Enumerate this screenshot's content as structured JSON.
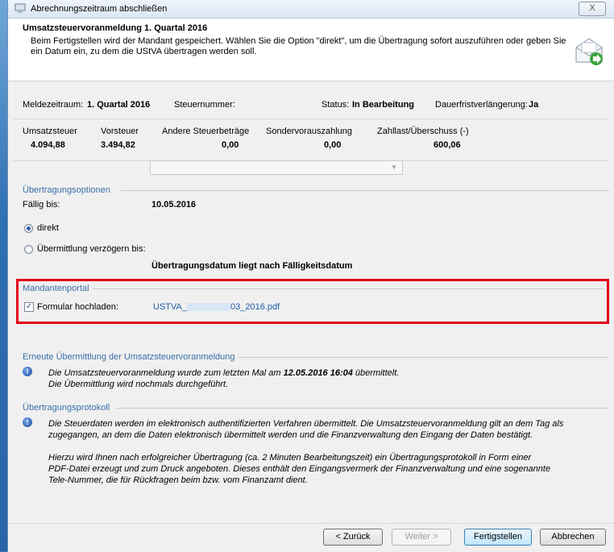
{
  "window": {
    "title": "Abrechnungszeitraum abschließen",
    "close_label": "X"
  },
  "header": {
    "title": "Umsatzsteuervoranmeldung 1. Quartal 2016",
    "description": "Beim Fertigstellen wird der Mandant gespeichert. Wählen Sie die Option \"direkt\", um die Übertragung sofort auszuführen oder geben Sie ein Datum ein, zu dem die UStVA übertragen werden soll."
  },
  "summary": {
    "meldezeitraum_label": "Meldezeitraum:",
    "meldezeitraum_value": "1. Quartal 2016",
    "steuernummer_label": "Steuernummer:",
    "status_label": "Status:",
    "status_value": "In Bearbeitung",
    "dauerfrist_label": "Dauerfristverlängerung:",
    "dauerfrist_value": "Ja"
  },
  "amounts": {
    "columns": [
      {
        "label": "Umsatzsteuer",
        "value": "4.094,88"
      },
      {
        "label": "Vorsteuer",
        "value": "3.494,82"
      },
      {
        "label": "Andere Steuerbeträge",
        "value": "0,00"
      },
      {
        "label": "Sondervorauszahlung",
        "value": "0,00"
      },
      {
        "label": "Zahllast/Überschuss (-)",
        "value": "600,06"
      }
    ]
  },
  "uebertragungsoptionen": {
    "group_title": "Übertragungsoptionen",
    "faellig_label": "Fällig bis:",
    "faellig_value": "10.05.2016",
    "option_direkt": "direkt",
    "option_verzoegern": "Übermittlung verzögern bis:",
    "warning": "Übertragungsdatum liegt nach Fälligkeitsdatum"
  },
  "mandantenportal": {
    "group_title": "Mandantenportal",
    "checkbox_label": "Formular hochladen:",
    "file_prefix": "USTVA_",
    "file_suffix": "03_2016.pdf"
  },
  "erneute": {
    "group_title": "Erneute Übermittlung der Umsatzsteuervoranmeldung",
    "line1_prefix": "Die Umsatzsteuervoranmeldung wurde zum letzten Mal am ",
    "line1_bold": "12.05.2016 16:04",
    "line1_suffix": " übermittelt.",
    "line2": "Die Übermittlung wird nochmals durchgeführt."
  },
  "protokoll": {
    "group_title": "Übertragungsprotokoll",
    "para1_line1": "Die Steuerdaten werden im elektronisch authentifizierten Verfahren übermittelt. Die Umsatzsteuervoranmeldung gilt an dem Tag als",
    "para1_line2": "zugegangen, an dem die Daten elektronisch übermittelt werden und die Finanzverwaltung den Eingang der Daten bestätigt.",
    "para2_line1": "Hierzu wird Ihnen nach erfolgreicher Übertragung (ca. 2 Minuten Bearbeitungszeit) ein Übertragungsprotokoll in Form einer",
    "para2_line2": "PDF-Datei erzeugt und zum Druck angeboten. Dieses enthält den Eingangsvermerk der Finanzverwaltung und eine sogenannte",
    "para2_line3": "Tele-Nummer, die für Rückfragen beim bzw. vom Finanzamt dient."
  },
  "buttons": {
    "back": "< Zurück",
    "next": "Weiter >",
    "finish": "Fertigstellen",
    "cancel": "Abbrechen"
  },
  "colors": {
    "accent": "#3a6ea8",
    "highlight_border": "#e3001b"
  }
}
